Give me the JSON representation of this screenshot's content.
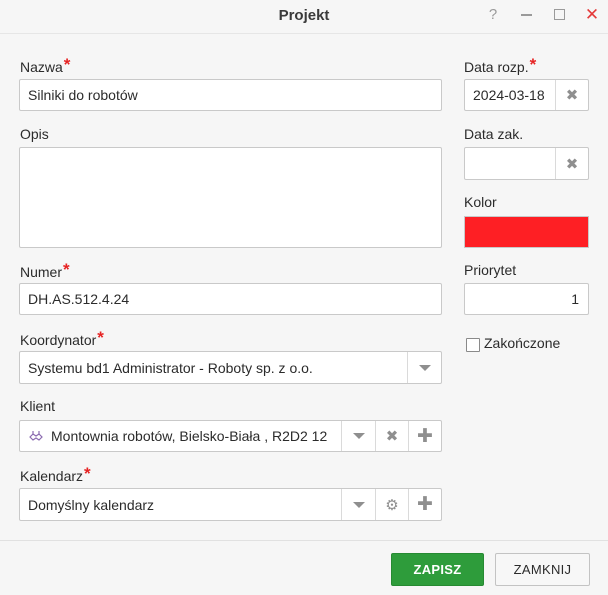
{
  "dialog": {
    "title": "Projekt",
    "help_icon": "?",
    "close_icon": "✕"
  },
  "form": {
    "name": {
      "label": "Nazwa",
      "value": "Silniki do robotów"
    },
    "description": {
      "label": "Opis",
      "value": ""
    },
    "number": {
      "label": "Numer",
      "value": "DH.AS.512.4.24"
    },
    "coordinator": {
      "label": "Koordynator",
      "value": "Systemu bd1 Administrator - Roboty sp. z o.o."
    },
    "client": {
      "label": "Klient",
      "value": "Montownia robotów, Bielsko-Biała , R2D2 12"
    },
    "calendar": {
      "label": "Kalendarz",
      "value": "Domyślny kalendarz"
    },
    "start_date": {
      "label": "Data rozp.",
      "value": "2024-03-18"
    },
    "end_date": {
      "label": "Data zak.",
      "value": ""
    },
    "color": {
      "label": "Kolor",
      "value": "#fe1f24"
    },
    "priority": {
      "label": "Priorytet",
      "value": "1"
    },
    "finished": {
      "label": "Zakończone",
      "checked": false
    },
    "required_mark": "*"
  },
  "buttons": {
    "save_label": "ZAPISZ",
    "close_label": "ZAMKNIJ"
  },
  "icons": {
    "clear": "✖",
    "plus": "✚",
    "gear": "⚙"
  },
  "colors": {
    "accent_green": "#2e9c3b",
    "required_red": "#e62222"
  }
}
